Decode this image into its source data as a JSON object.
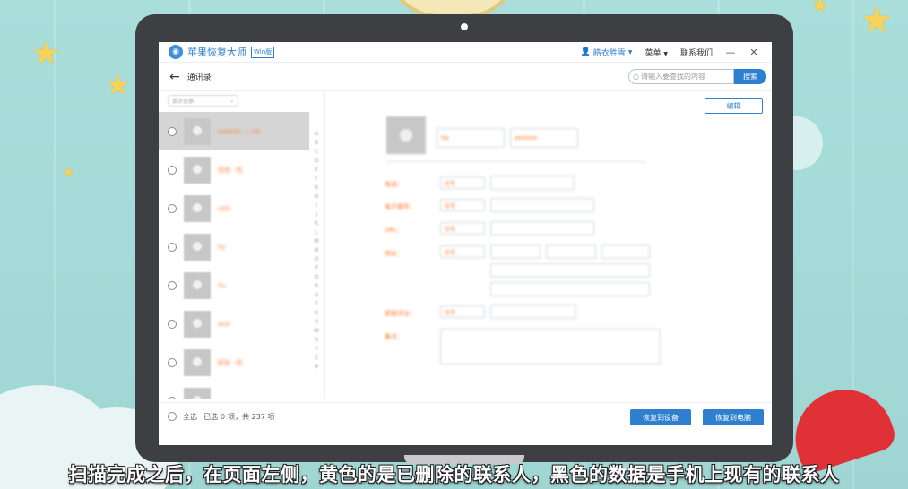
{
  "app": {
    "name": "苹果恢复大师",
    "edition_badge": "Win版",
    "user": "皓衣胜雪",
    "menu_label": "菜单",
    "contact_label": "联系我们",
    "minimize": "—",
    "close": "✕"
  },
  "nav": {
    "back": "←",
    "title": "通讯录",
    "search_placeholder": "请输入要查找的内容",
    "search_button": "搜索"
  },
  "list": {
    "filter_label": "显示全部",
    "contacts": [
      {
        "name": "eeeeee — cle",
        "selected": true
      },
      {
        "name": "佳佳 · 机",
        "selected": false
      },
      {
        "name": "cjcb",
        "selected": false
      },
      {
        "name": "hy",
        "selected": false
      },
      {
        "name": "hu",
        "selected": false
      },
      {
        "name": "wuli",
        "selected": false
      },
      {
        "name": "好友 · 机",
        "selected": false
      },
      {
        "name": "",
        "selected": false
      }
    ],
    "alphabet": "ABCDEFGHIJKLMNOPQRSTUVWXYZ#"
  },
  "detail": {
    "edit_button": "编辑",
    "first_name": "ha",
    "last_name": "eeeeee",
    "labels": {
      "phone": "电话：",
      "email": "电子邮件：",
      "url": "URL：",
      "address": "地址：",
      "birthday": "家庭住址：",
      "note": "备注："
    },
    "select_value": "住宅"
  },
  "footer": {
    "select_all": "全选",
    "selected_prefix": "已选",
    "selected_count": "0",
    "selected_suffix": "项，共 237 项",
    "restore_device": "恢复到设备",
    "restore_pc": "恢复到电脑"
  },
  "subtitle": "扫描完成之后，在页面左侧，黄色的是已删除的联系人，黑色的数据是手机上现有的联系人",
  "colors": {
    "accent": "#2f7fd0",
    "deleted_contact": "#ff7a2b",
    "laptop_frame": "#3d3f43",
    "background": "#a8dcd9"
  }
}
